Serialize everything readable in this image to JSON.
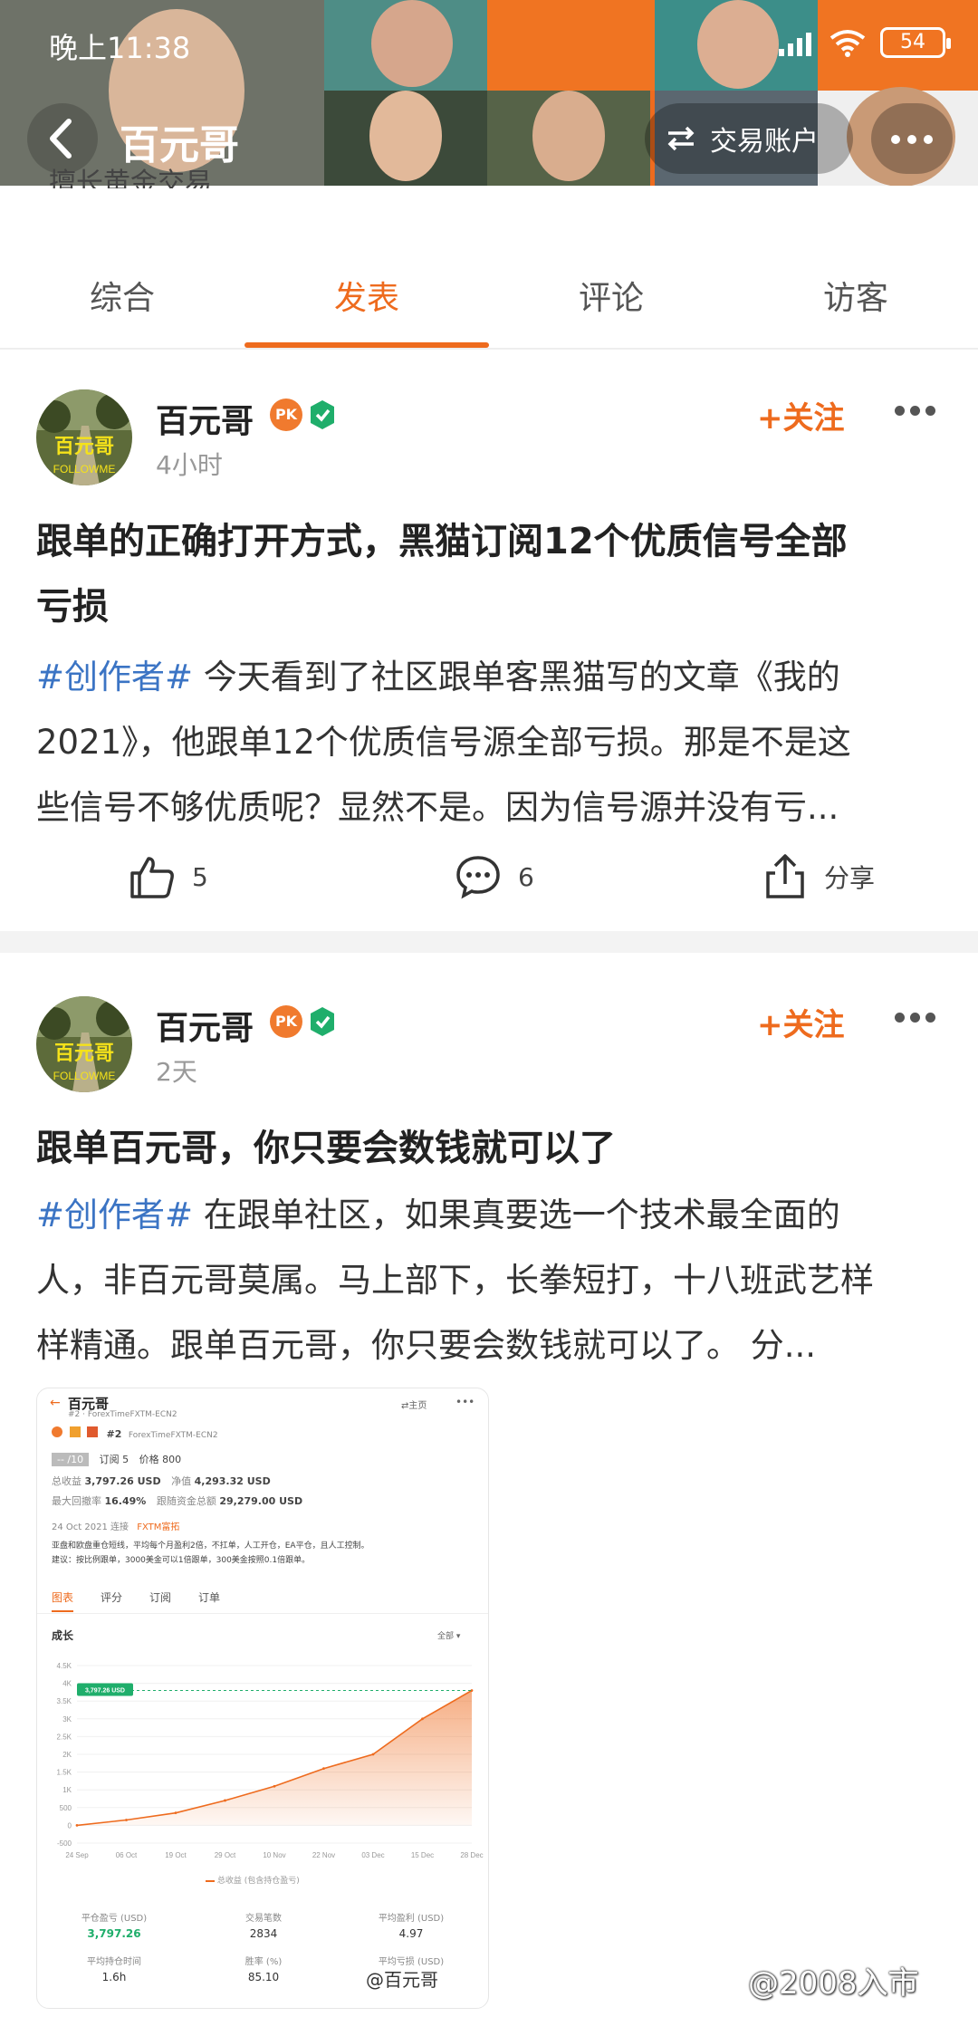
{
  "status": {
    "time": "晚上11:38",
    "battery": "54"
  },
  "nav": {
    "title": "百元哥",
    "account_button": "交易账户",
    "bio": "擅长黄金交易"
  },
  "tabs": [
    {
      "label": "综合",
      "active": false
    },
    {
      "label": "发表",
      "active": true
    },
    {
      "label": "评论",
      "active": false
    },
    {
      "label": "访客",
      "active": false
    }
  ],
  "posts": [
    {
      "author": "百元哥",
      "time": "4小时",
      "follow": "+关注",
      "title_line1": "跟单的正确打开方式，黑猫订阅12个优质信号全部",
      "title_line2": "亏损",
      "hashtag": "#创作者#",
      "body_line1": " 今天看到了社区跟单客黑猫写的文章《我的",
      "body_line2": "2021》，他跟单12个优质信号源全部亏损。那是不是这",
      "body_line3": "些信号不够优质呢？显然不是。因为信号源并没有亏...",
      "likes": "5",
      "comments": "6",
      "share": "分享"
    },
    {
      "author": "百元哥",
      "time": "2天",
      "follow": "+关注",
      "title": "跟单百元哥，你只要会数钱就可以了",
      "hashtag": "#创作者#",
      "body_line1": " 在跟单社区，如果真要选一个技术最全面的",
      "body_line2": "人，非百元哥莫属。马上部下，长拳短打，十八班武艺样",
      "body_line3": "样精通。跟单百元哥，你只要会数钱就可以了。 分..."
    }
  ],
  "avatar_text": {
    "top": "百元哥",
    "bottom": "FOLLOWME"
  },
  "embedded": {
    "name": "百元哥",
    "account": "#2 · ForexTimeFXTM-ECN2",
    "home": "⇄主页",
    "rank": "#2",
    "broker": "ForexTimeFXTM-ECN2",
    "score": "-- /10",
    "subs": "订阅 5",
    "price": "价格 800",
    "total_profit_label": "总收益",
    "total_profit": "3,797.26 USD",
    "equity_label": "净值",
    "equity": "4,293.32 USD",
    "drawdown_label": "最大回撤率",
    "drawdown": "16.49%",
    "follow_funds_label": "跟随资金总额",
    "follow_funds": "29,279.00 USD",
    "connected": "24 Oct 2021 连接",
    "broker_link": "FXTM富拓",
    "desc1": "亚盘和欧盘重仓短线，平均每个月盈利2倍，不扛单，人工开仓，EA平仓，且人工控制。",
    "desc2": "建议：按比例跟单，3000美金可以1倍跟单，300美金按照0.1倍跟单。",
    "tabs": [
      "图表",
      "评分",
      "订阅",
      "订单"
    ],
    "section": "成长",
    "filter": "全部 ▾",
    "legend": "总收益 (包含持仓盈亏)",
    "stats": [
      {
        "label": "平仓盈亏 (USD)",
        "value": "3,797.26"
      },
      {
        "label": "交易笔数",
        "value": "2834"
      },
      {
        "label": "平均盈利 (USD)",
        "value": "4.97"
      },
      {
        "label": "平均持仓时间",
        "value": "1.6h"
      },
      {
        "label": "胜率 (%)",
        "value": "85.10"
      },
      {
        "label": "平均亏损 (USD)",
        "value": ""
      }
    ],
    "watermark": "@百元哥"
  },
  "chart_data": {
    "type": "area",
    "x": [
      "24 Sep",
      "06 Oct",
      "19 Oct",
      "29 Oct",
      "10 Nov",
      "22 Nov",
      "03 Dec",
      "15 Dec",
      "28 Dec"
    ],
    "y_ticks": [
      "4.5K",
      "4K",
      "3.5K",
      "3K",
      "2.5K",
      "2K",
      "1.5K",
      "1K",
      "500",
      "0",
      "-500"
    ],
    "values": [
      0,
      150,
      350,
      700,
      1100,
      1600,
      2000,
      3000,
      3797.26
    ],
    "ylim": [
      -500,
      4500
    ],
    "highlight": "3,797.26 USD",
    "series_name": "总收益 (包含持仓盈亏)",
    "color": "#ee6b1e"
  },
  "page_watermark": "@2008入市"
}
